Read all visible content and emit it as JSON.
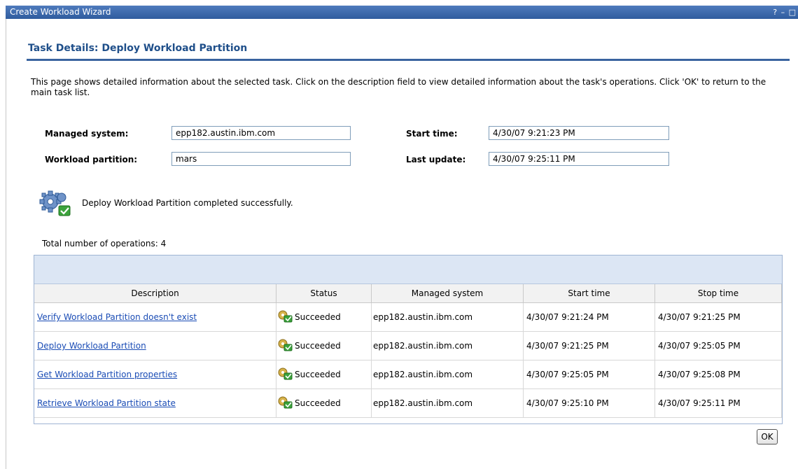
{
  "window": {
    "title": "Create Workload Wizard",
    "controls": "? – □"
  },
  "page": {
    "heading": "Task Details: Deploy Workload Partition",
    "intro": "This page shows detailed information about the selected task. Click on the description field to view detailed information about the task's operations. Click 'OK' to return to the main task list."
  },
  "form": {
    "managed_system_label": "Managed system:",
    "managed_system_value": "epp182.austin.ibm.com",
    "workload_partition_label": "Workload partition:",
    "workload_partition_value": "mars",
    "start_time_label": "Start time:",
    "start_time_value": "4/30/07 9:21:23 PM",
    "last_update_label": "Last update:",
    "last_update_value": "4/30/07 9:25:11 PM"
  },
  "status": {
    "icon": "gear-check-icon",
    "message": "Deploy Workload Partition completed successfully."
  },
  "operations": {
    "total_text": "Total number of operations: 4",
    "columns": [
      "Description",
      "Status",
      "Managed system",
      "Start time",
      "Stop time"
    ],
    "rows": [
      {
        "description": "Verify Workload Partition doesn't exist",
        "status": "Succeeded",
        "managed_system": "epp182.austin.ibm.com",
        "start": "4/30/07 9:21:24 PM",
        "stop": "4/30/07 9:21:25 PM"
      },
      {
        "description": "Deploy Workload Partition",
        "status": "Succeeded",
        "managed_system": "epp182.austin.ibm.com",
        "start": "4/30/07 9:21:25 PM",
        "stop": "4/30/07 9:25:05 PM"
      },
      {
        "description": "Get Workload Partition properties",
        "status": "Succeeded",
        "managed_system": "epp182.austin.ibm.com",
        "start": "4/30/07 9:25:05 PM",
        "stop": "4/30/07 9:25:08 PM"
      },
      {
        "description": "Retrieve Workload Partition state",
        "status": "Succeeded",
        "managed_system": "epp182.austin.ibm.com",
        "start": "4/30/07 9:25:10 PM",
        "stop": "4/30/07 9:25:11 PM"
      }
    ]
  },
  "buttons": {
    "ok_label": "OK"
  },
  "colors": {
    "accent": "#1f4f8a",
    "link": "#1a4cb5",
    "titlebar": "#2f5c9e",
    "success": "#3ca33c"
  }
}
